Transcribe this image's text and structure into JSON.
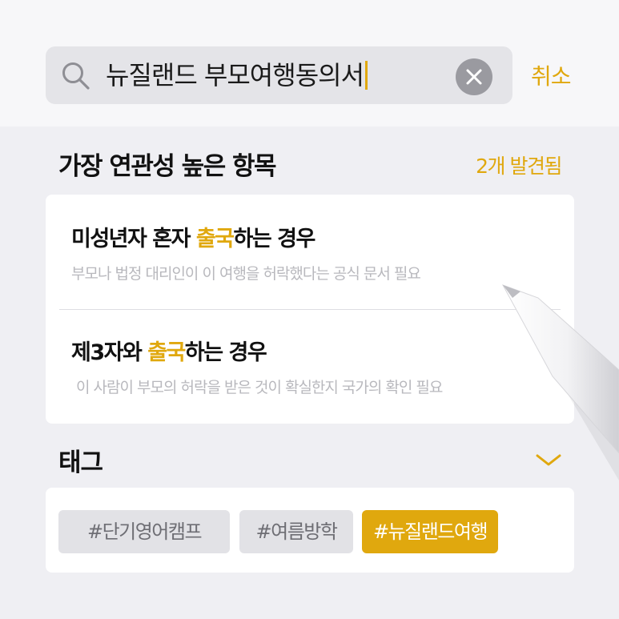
{
  "search": {
    "query": "뉴질랜드 부모여행동의서",
    "cancel_label": "취소"
  },
  "results": {
    "title": "가장 연관성 높은 항목",
    "count_label": "2개 발견됨",
    "items": [
      {
        "title_before": "미성년자 혼자 ",
        "title_highlight": "출국",
        "title_after": "하는 경우",
        "description": "부모나 법정 대리인이 이 여행을 허락했다는 공식 문서 필요"
      },
      {
        "title_before": "제3자와 ",
        "title_highlight": "출국",
        "title_after": "하는 경우",
        "description": "이 사람이 부모의 허락을 받은 것이 확실한지 국가의 확인 필요"
      }
    ]
  },
  "tags": {
    "title": "태그",
    "items": [
      "#단기영어캠프",
      "#여름방학",
      "#뉴질랜드여행"
    ],
    "selected_index": 2
  },
  "colors": {
    "accent": "#e0a80e",
    "background": "#efeff3",
    "card": "#ffffff",
    "muted_text": "#b8b8bd"
  },
  "icons": [
    "search-icon",
    "clear-icon",
    "chevron-down-icon",
    "stylus-pencil"
  ]
}
